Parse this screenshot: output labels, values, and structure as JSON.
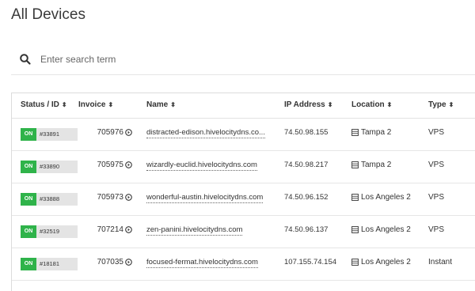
{
  "page": {
    "title": "All Devices"
  },
  "search": {
    "placeholder": "Enter search term",
    "value": "",
    "icon": "search-icon"
  },
  "table": {
    "columns": [
      {
        "key": "status",
        "label": "Status / ID"
      },
      {
        "key": "invoice",
        "label": "Invoice"
      },
      {
        "key": "name",
        "label": "Name"
      },
      {
        "key": "ip",
        "label": "IP Address"
      },
      {
        "key": "location",
        "label": "Location"
      },
      {
        "key": "type",
        "label": "Type"
      }
    ],
    "sort_glyph": "⬍",
    "rows": [
      {
        "status": "ON",
        "id": "#33891",
        "invoice": "705976",
        "name": "distracted-edison.hivelocitydns.co...",
        "ip": "74.50.98.155",
        "location": "Tampa 2",
        "type": "VPS"
      },
      {
        "status": "ON",
        "id": "#33890",
        "invoice": "705975",
        "name": "wizardly-euclid.hivelocitydns.com",
        "ip": "74.50.98.217",
        "location": "Tampa 2",
        "type": "VPS"
      },
      {
        "status": "ON",
        "id": "#33888",
        "invoice": "705973",
        "name": "wonderful-austin.hivelocitydns.com",
        "ip": "74.50.96.152",
        "location": "Los Angeles 2",
        "type": "VPS"
      },
      {
        "status": "ON",
        "id": "#32519",
        "invoice": "707214",
        "name": "zen-panini.hivelocitydns.com",
        "ip": "74.50.96.137",
        "location": "Los Angeles 2",
        "type": "VPS"
      },
      {
        "status": "ON",
        "id": "#18181",
        "invoice": "707035",
        "name": "focused-fermat.hivelocitydns.com",
        "ip": "107.155.74.154",
        "location": "Los Angeles 2",
        "type": "Instant"
      }
    ]
  },
  "colors": {
    "status_on": "#2fb34a",
    "id_badge": "#e4e4e4"
  }
}
